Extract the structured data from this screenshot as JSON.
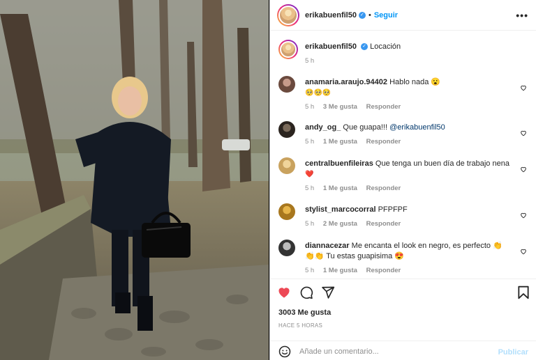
{
  "post": {
    "username": "erikabuenfil50",
    "follow_label": "Seguir",
    "separator": "•",
    "more_label": "•••"
  },
  "caption": {
    "username": "erikabuenfil50",
    "text": "Locación",
    "time": "5 h"
  },
  "comments": [
    {
      "username": "anamaria.araujo.94402",
      "text": "Hablo nada 😮",
      "text2": "🥺🥺🥺",
      "time": "5 h",
      "likes": "3 Me gusta",
      "reply": "Responder"
    },
    {
      "username": "andy_og_",
      "text": "Que guapa!!! ",
      "mention": "@erikabuenfil50",
      "time": "5 h",
      "likes": "1 Me gusta",
      "reply": "Responder"
    },
    {
      "username": "centralbuenfileiras",
      "text": "Que tenga un buen día de trabajo nena",
      "text2": "❤️",
      "time": "5 h",
      "likes": "1 Me gusta",
      "reply": "Responder"
    },
    {
      "username": "stylist_marcocorral",
      "text": "PFPFPF",
      "time": "5 h",
      "likes": "2 Me gusta",
      "reply": "Responder"
    },
    {
      "username": "diannacezar",
      "text": "Me encanta el look en negro, es perfecto 👏",
      "text2": "👏👏 Tu estas guapisima 😍",
      "time": "5 h",
      "likes": "1 Me gusta",
      "reply": "Responder"
    }
  ],
  "actions": {
    "like_icon": "heart-filled-icon",
    "comment_icon": "speech-bubble-icon",
    "share_icon": "paper-plane-icon",
    "save_icon": "bookmark-icon",
    "like_color": "#ed4956"
  },
  "likes_text": "3003 Me gusta",
  "time_ago": "HACE 5 HORAS",
  "add_comment": {
    "placeholder": "Añade un comentario...",
    "publish_label": "Publicar",
    "emoji_icon": "smiley-icon"
  },
  "colors": {
    "accent": "#0095f6",
    "verified": "#3897f0",
    "muted": "#8e8e8e"
  }
}
